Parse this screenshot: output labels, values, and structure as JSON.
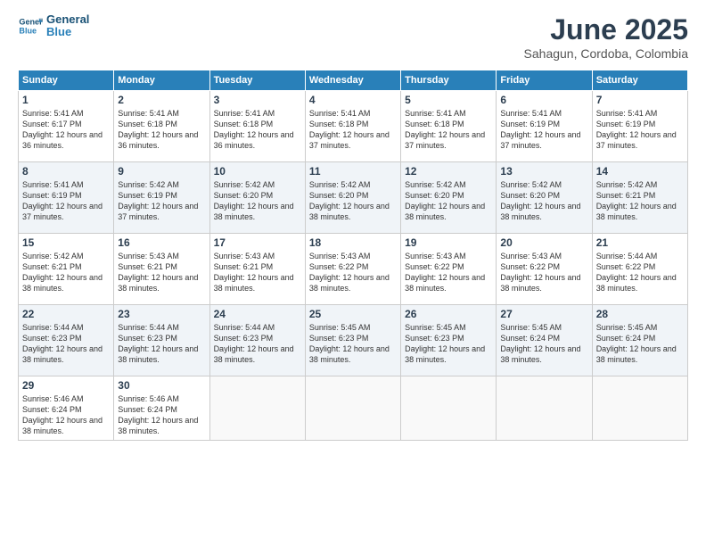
{
  "header": {
    "logo": {
      "line1": "General",
      "line2": "Blue"
    },
    "title": "June 2025",
    "location": "Sahagun, Cordoba, Colombia"
  },
  "calendar": {
    "headers": [
      "Sunday",
      "Monday",
      "Tuesday",
      "Wednesday",
      "Thursday",
      "Friday",
      "Saturday"
    ],
    "weeks": [
      [
        {
          "day": "1",
          "sunrise": "5:41 AM",
          "sunset": "6:17 PM",
          "daylight": "12 hours and 36 minutes."
        },
        {
          "day": "2",
          "sunrise": "5:41 AM",
          "sunset": "6:18 PM",
          "daylight": "12 hours and 36 minutes."
        },
        {
          "day": "3",
          "sunrise": "5:41 AM",
          "sunset": "6:18 PM",
          "daylight": "12 hours and 36 minutes."
        },
        {
          "day": "4",
          "sunrise": "5:41 AM",
          "sunset": "6:18 PM",
          "daylight": "12 hours and 37 minutes."
        },
        {
          "day": "5",
          "sunrise": "5:41 AM",
          "sunset": "6:18 PM",
          "daylight": "12 hours and 37 minutes."
        },
        {
          "day": "6",
          "sunrise": "5:41 AM",
          "sunset": "6:19 PM",
          "daylight": "12 hours and 37 minutes."
        },
        {
          "day": "7",
          "sunrise": "5:41 AM",
          "sunset": "6:19 PM",
          "daylight": "12 hours and 37 minutes."
        }
      ],
      [
        {
          "day": "8",
          "sunrise": "5:41 AM",
          "sunset": "6:19 PM",
          "daylight": "12 hours and 37 minutes."
        },
        {
          "day": "9",
          "sunrise": "5:42 AM",
          "sunset": "6:19 PM",
          "daylight": "12 hours and 37 minutes."
        },
        {
          "day": "10",
          "sunrise": "5:42 AM",
          "sunset": "6:20 PM",
          "daylight": "12 hours and 38 minutes."
        },
        {
          "day": "11",
          "sunrise": "5:42 AM",
          "sunset": "6:20 PM",
          "daylight": "12 hours and 38 minutes."
        },
        {
          "day": "12",
          "sunrise": "5:42 AM",
          "sunset": "6:20 PM",
          "daylight": "12 hours and 38 minutes."
        },
        {
          "day": "13",
          "sunrise": "5:42 AM",
          "sunset": "6:20 PM",
          "daylight": "12 hours and 38 minutes."
        },
        {
          "day": "14",
          "sunrise": "5:42 AM",
          "sunset": "6:21 PM",
          "daylight": "12 hours and 38 minutes."
        }
      ],
      [
        {
          "day": "15",
          "sunrise": "5:42 AM",
          "sunset": "6:21 PM",
          "daylight": "12 hours and 38 minutes."
        },
        {
          "day": "16",
          "sunrise": "5:43 AM",
          "sunset": "6:21 PM",
          "daylight": "12 hours and 38 minutes."
        },
        {
          "day": "17",
          "sunrise": "5:43 AM",
          "sunset": "6:21 PM",
          "daylight": "12 hours and 38 minutes."
        },
        {
          "day": "18",
          "sunrise": "5:43 AM",
          "sunset": "6:22 PM",
          "daylight": "12 hours and 38 minutes."
        },
        {
          "day": "19",
          "sunrise": "5:43 AM",
          "sunset": "6:22 PM",
          "daylight": "12 hours and 38 minutes."
        },
        {
          "day": "20",
          "sunrise": "5:43 AM",
          "sunset": "6:22 PM",
          "daylight": "12 hours and 38 minutes."
        },
        {
          "day": "21",
          "sunrise": "5:44 AM",
          "sunset": "6:22 PM",
          "daylight": "12 hours and 38 minutes."
        }
      ],
      [
        {
          "day": "22",
          "sunrise": "5:44 AM",
          "sunset": "6:23 PM",
          "daylight": "12 hours and 38 minutes."
        },
        {
          "day": "23",
          "sunrise": "5:44 AM",
          "sunset": "6:23 PM",
          "daylight": "12 hours and 38 minutes."
        },
        {
          "day": "24",
          "sunrise": "5:44 AM",
          "sunset": "6:23 PM",
          "daylight": "12 hours and 38 minutes."
        },
        {
          "day": "25",
          "sunrise": "5:45 AM",
          "sunset": "6:23 PM",
          "daylight": "12 hours and 38 minutes."
        },
        {
          "day": "26",
          "sunrise": "5:45 AM",
          "sunset": "6:23 PM",
          "daylight": "12 hours and 38 minutes."
        },
        {
          "day": "27",
          "sunrise": "5:45 AM",
          "sunset": "6:24 PM",
          "daylight": "12 hours and 38 minutes."
        },
        {
          "day": "28",
          "sunrise": "5:45 AM",
          "sunset": "6:24 PM",
          "daylight": "12 hours and 38 minutes."
        }
      ],
      [
        {
          "day": "29",
          "sunrise": "5:46 AM",
          "sunset": "6:24 PM",
          "daylight": "12 hours and 38 minutes."
        },
        {
          "day": "30",
          "sunrise": "5:46 AM",
          "sunset": "6:24 PM",
          "daylight": "12 hours and 38 minutes."
        },
        null,
        null,
        null,
        null,
        null
      ]
    ],
    "labels": {
      "sunrise": "Sunrise:",
      "sunset": "Sunset:",
      "daylight": "Daylight:"
    }
  }
}
